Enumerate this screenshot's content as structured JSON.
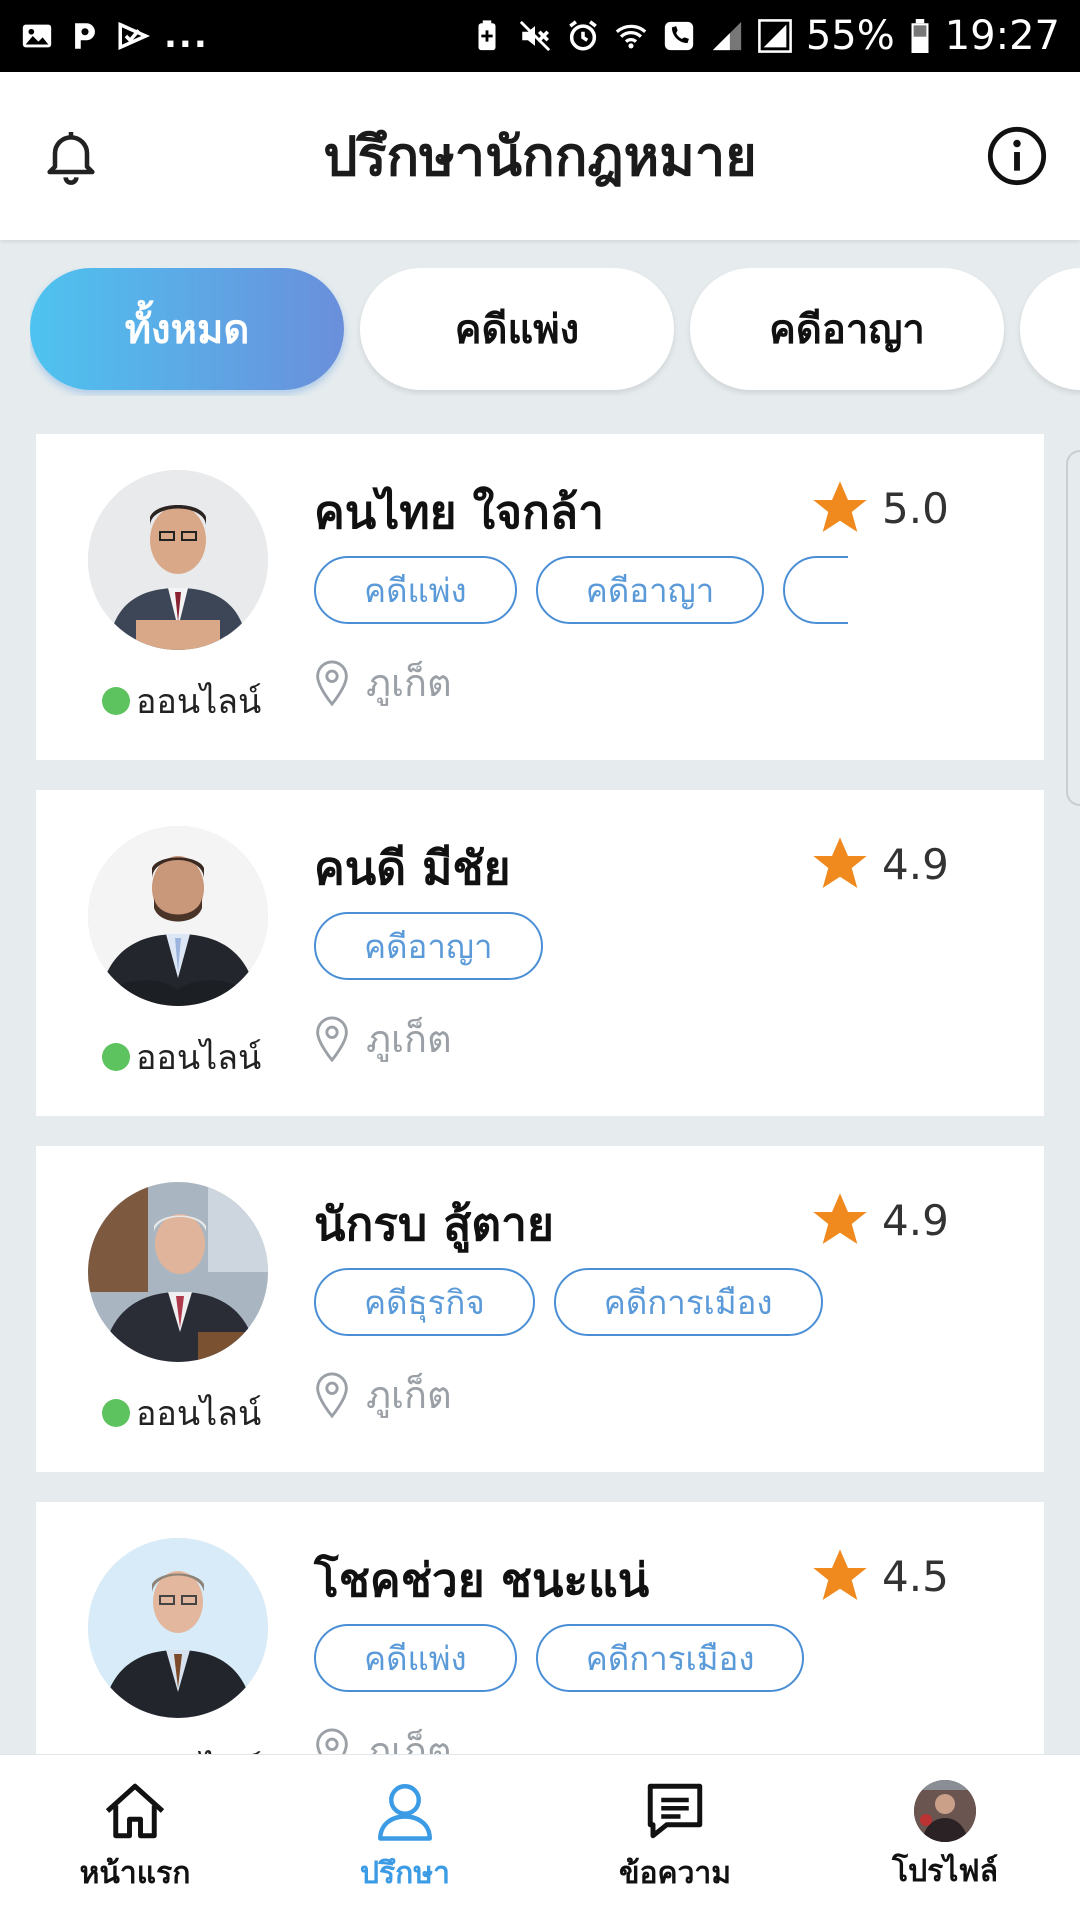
{
  "status_bar": {
    "battery": "55%",
    "time": "19:27",
    "more": "...",
    "left_icons": [
      "image-icon",
      "p-icon",
      "check-icon"
    ],
    "right_icons": [
      "battery-saver-icon",
      "mute-icon",
      "alarm-icon",
      "wifi-icon",
      "call-icon",
      "signal-icon",
      "signal-icon-2",
      "battery-icon"
    ]
  },
  "header": {
    "title": "ปรึกษานักกฎหมาย",
    "left_icon": "bell-icon",
    "right_icon": "info-icon"
  },
  "filters": [
    {
      "label": "ทั้งหมด",
      "active": true
    },
    {
      "label": "คดีแพ่ง",
      "active": false
    },
    {
      "label": "คดีอาญา",
      "active": false
    },
    {
      "label": "",
      "active": false
    }
  ],
  "lawyers": [
    {
      "name": "คนไทย ใจกล้า",
      "rating": "5.0",
      "tags": [
        "คดีแพ่ง",
        "คดีอาญา",
        ""
      ],
      "location": "ภูเก็ต",
      "status": "ออนไลน์"
    },
    {
      "name": "คนดี มีชัย",
      "rating": "4.9",
      "tags": [
        "คดีอาญา"
      ],
      "location": "ภูเก็ต",
      "status": "ออนไลน์"
    },
    {
      "name": "นักรบ สู้ตาย",
      "rating": "4.9",
      "tags": [
        "คดีธุรกิจ",
        "คดีการเมือง"
      ],
      "location": "ภูเก็ต",
      "status": "ออนไลน์"
    },
    {
      "name": "โชคช่วย ชนะแน่",
      "rating": "4.5",
      "tags": [
        "คดีแพ่ง",
        "คดีการเมือง"
      ],
      "location": "ภูเก็ต",
      "status": "ออนไลน์"
    }
  ],
  "bottom_nav": [
    {
      "label": "หน้าแรก",
      "icon": "home-icon",
      "active": false
    },
    {
      "label": "ปรึกษา",
      "icon": "user-icon",
      "active": true
    },
    {
      "label": "ข้อความ",
      "icon": "message-icon",
      "active": false
    },
    {
      "label": "โปรไฟล์",
      "icon": "profile-avatar",
      "active": false
    }
  ],
  "colors": {
    "accent": "#3b9be5",
    "online": "#5cc35e",
    "star": "#f0891e",
    "tag_border": "#4a8fd6",
    "background": "#e6ecee"
  }
}
